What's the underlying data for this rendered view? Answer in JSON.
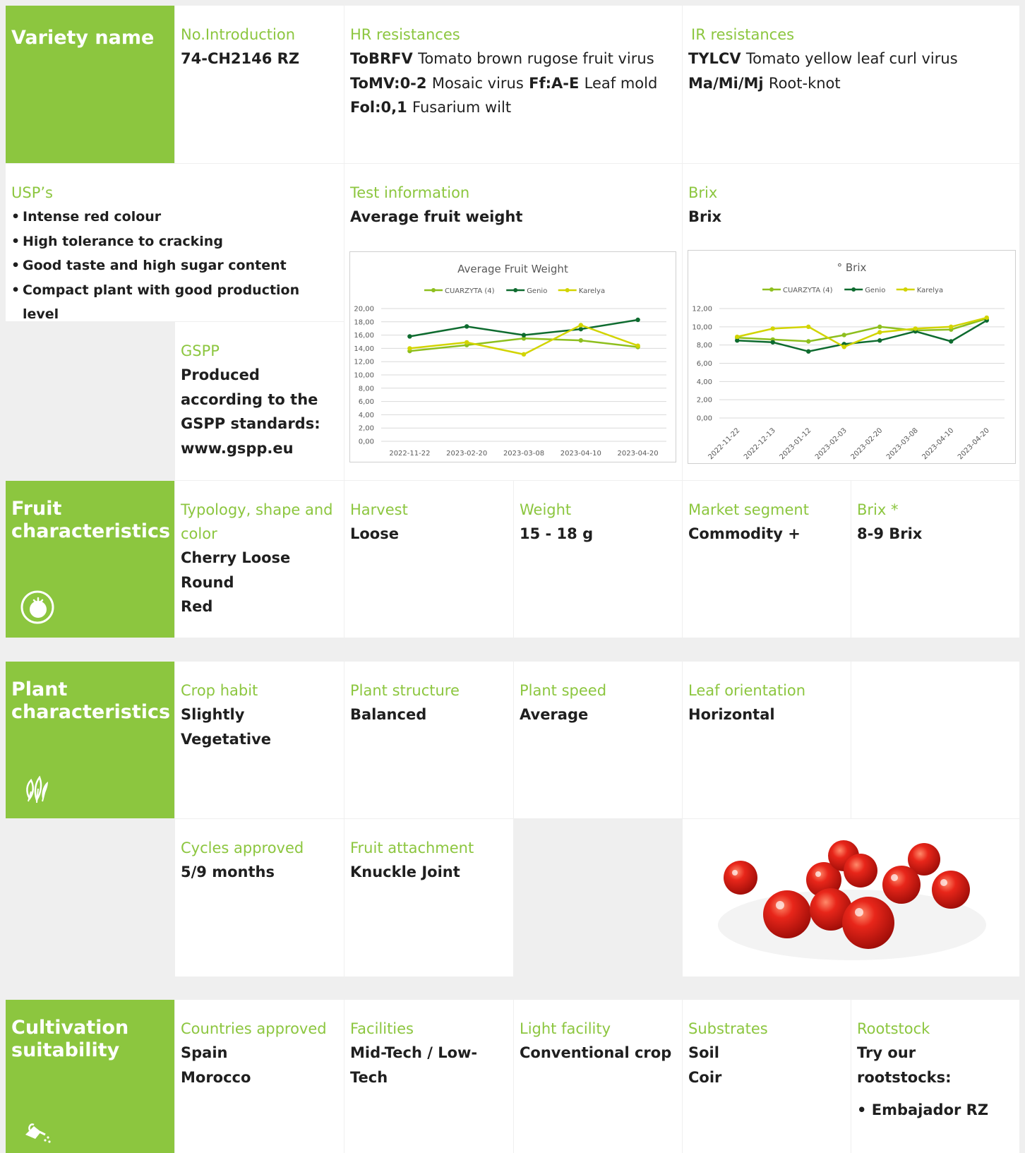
{
  "variety": {
    "section_title": "Variety name",
    "no_intro_label": "No.Introduction",
    "no_intro_value": "74-CH2146 RZ",
    "hr_label": "HR resistances",
    "hr": [
      {
        "code": "ToBRFV",
        "name": "Tomato brown rugose fruit virus"
      },
      {
        "code": "ToMV:0-2",
        "name": "Mosaic virus"
      },
      {
        "code": "Ff:A-E",
        "name": "Leaf mold"
      },
      {
        "code": "Fol:0,1",
        "name": "Fusarium wilt"
      }
    ],
    "ir_label": "IR resistances",
    "ir": [
      {
        "code": "TYLCV",
        "name": "Tomato yellow leaf curl virus"
      },
      {
        "code": "Ma/Mi/Mj",
        "name": "Root-knot"
      }
    ]
  },
  "usps": {
    "label": "USP’s",
    "items": [
      "Intense red colour",
      "High tolerance to cracking",
      "Good taste and high sugar content",
      "Compact plant with good production level"
    ]
  },
  "gspp": {
    "label": "GSPP",
    "lines": [
      "Produced",
      "according to the",
      "GSPP standards:",
      "www.gspp.eu"
    ]
  },
  "test_info": {
    "label": "Test information",
    "value": "Average fruit weight"
  },
  "brix_info": {
    "label": "Brix",
    "value": "Brix"
  },
  "chart_data": [
    {
      "type": "line",
      "title": "Average Fruit Weight",
      "x": [
        "2022-11-22",
        "2023-02-20",
        "2023-03-08",
        "2023-04-10",
        "2023-04-20"
      ],
      "y_ticks": [
        "0,00",
        "2,00",
        "4,00",
        "6,00",
        "8,00",
        "10,00",
        "12,00",
        "14,00",
        "16,00",
        "18,00",
        "20,00"
      ],
      "ylim": [
        0,
        20
      ],
      "series": [
        {
          "name": "CUARZYTA (4)",
          "color": "#8ebf1e",
          "values": [
            13.6,
            14.5,
            15.5,
            15.2,
            14.2
          ]
        },
        {
          "name": "Genio",
          "color": "#0e6b2f",
          "values": [
            15.8,
            17.3,
            16.0,
            16.9,
            18.3
          ]
        },
        {
          "name": "Karelya",
          "color": "#d2d400",
          "values": [
            14.0,
            14.9,
            13.1,
            17.5,
            14.4
          ]
        }
      ],
      "legend": "top",
      "grid": true
    },
    {
      "type": "line",
      "title": "° Brix",
      "x": [
        "2022-11-22",
        "2022-12-13",
        "2023-01-12",
        "2023-02-03",
        "2023-02-20",
        "2023-03-08",
        "2023-04-10",
        "2023-04-20"
      ],
      "y_ticks": [
        "0,00",
        "2,00",
        "4,00",
        "6,00",
        "8,00",
        "10,00",
        "12,00"
      ],
      "ylim": [
        0,
        12
      ],
      "series": [
        {
          "name": "CUARZYTA (4)",
          "color": "#8ebf1e",
          "values": [
            8.8,
            8.6,
            8.4,
            9.1,
            10.0,
            9.6,
            9.7,
            10.9
          ]
        },
        {
          "name": "Genio",
          "color": "#0e6b2f",
          "values": [
            8.5,
            8.3,
            7.3,
            8.1,
            8.5,
            9.5,
            8.4,
            10.7
          ]
        },
        {
          "name": "Karelya",
          "color": "#d2d400",
          "values": [
            8.9,
            9.8,
            10.0,
            7.8,
            9.4,
            9.8,
            10.0,
            11.0
          ]
        }
      ],
      "legend": "top",
      "grid": true
    }
  ],
  "fruit": {
    "section_title": [
      "Fruit",
      "characteristics"
    ],
    "icon": "tomato-icon",
    "typology_label": [
      "Typology, shape and",
      "color"
    ],
    "typology_values": [
      "Cherry Loose",
      "Round",
      "Red"
    ],
    "harvest_label": "Harvest",
    "harvest_value": "Loose",
    "weight_label": "Weight",
    "weight_value": "15 - 18 g",
    "market_label": "Market segment",
    "market_value": "Commodity +",
    "brix_label": "Brix *",
    "brix_value": "8-9 Brix"
  },
  "plant": {
    "section_title": [
      "Plant",
      "characteristics"
    ],
    "icon": "leaves-icon",
    "crop_label": "Crop habit",
    "crop_value": "Slightly Vegetative",
    "structure_label": "Plant structure",
    "structure_value": "Balanced",
    "speed_label": "Plant speed",
    "speed_value": "Average",
    "leaf_label": "Leaf orientation",
    "leaf_value": "Horizontal",
    "cycles_label": "Cycles approved",
    "cycles_value": "5/9 months",
    "attach_label": "Fruit attachment",
    "attach_value": "Knuckle Joint",
    "photo": "cherry-tomatoes-photo"
  },
  "cultivation": {
    "section_title": [
      "Cultivation",
      "suitability"
    ],
    "icon": "watering-can-icon",
    "countries_label": "Countries approved",
    "countries_values": [
      "Spain",
      "Morocco"
    ],
    "facilities_label": "Facilities",
    "facilities_value": "Mid-Tech / Low-Tech",
    "light_label": "Light facility",
    "light_value": "Conventional crop",
    "substrates_label": "Substrates",
    "substrates_values": [
      "Soil",
      "Coir"
    ],
    "rootstock_label": "Rootstock",
    "rootstock_value": "Try our rootstocks:",
    "rootstock_items": [
      "• Embajador RZ"
    ]
  },
  "colors": {
    "brand_green": "#8cc63f",
    "text": "#1f1f1f"
  }
}
